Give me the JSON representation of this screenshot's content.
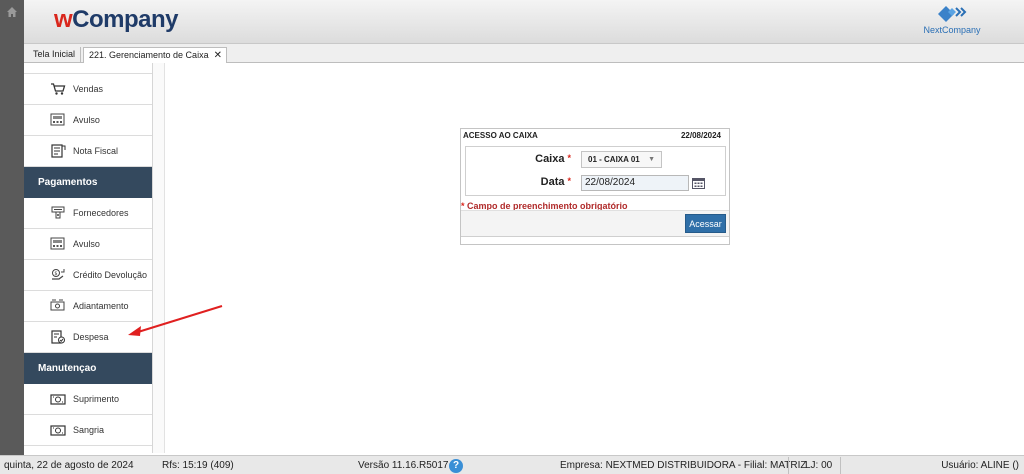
{
  "header": {
    "logo_w": "w",
    "logo_company": "Company",
    "partner_label": "NextCompany"
  },
  "tabs": [
    {
      "label": "Tela Inicial"
    },
    {
      "label": "221. Gerenciamento de Caixa",
      "close": "✕"
    }
  ],
  "sidebar": {
    "items": [
      {
        "label": "Vendas",
        "icon": "cart-icon"
      },
      {
        "label": "Avulso",
        "icon": "register-icon"
      },
      {
        "label": "Nota Fiscal",
        "icon": "invoice-icon"
      },
      {
        "section": "Pagamentos"
      },
      {
        "label": "Fornecedores",
        "icon": "supplier-icon"
      },
      {
        "label": "Avulso",
        "icon": "register-icon"
      },
      {
        "label": "Crédito Devolução",
        "icon": "credit-return-icon"
      },
      {
        "label": "Adiantamento",
        "icon": "advance-icon"
      },
      {
        "label": "Despesa",
        "icon": "expense-icon"
      },
      {
        "section": "Manutençao"
      },
      {
        "label": "Suprimento",
        "icon": "cash-in-icon"
      },
      {
        "label": "Sangria",
        "icon": "cash-out-icon"
      }
    ]
  },
  "dialog": {
    "title": "ACESSO AO CAIXA",
    "date": "22/08/2024",
    "caixa_label": "Caixa",
    "caixa_value": "01 - CAIXA 01",
    "data_label": "Data",
    "data_value": "22/08/2024",
    "required_star": "*",
    "required_note": "Campo de preenchimento obrigatório",
    "submit_label": "Acessar"
  },
  "status": {
    "datetime": "quinta, 22 de agosto de 2024",
    "rfs": "Rfs: 15:19 (409)",
    "version": "Versão 11.16.R5017",
    "help": "?",
    "company": "Empresa: NEXTMED DISTRIBUIDORA - Filial: MATRIZ",
    "store": "LJ: 00",
    "user": "Usuário: ALINE ()"
  },
  "colors": {
    "sidebar_section": "#34495e",
    "primary_button": "#2f6fa8",
    "required_text": "#b02a2a",
    "logo_red": "#d9261c",
    "logo_blue": "#1f3b68",
    "arrow": "#e02020"
  }
}
